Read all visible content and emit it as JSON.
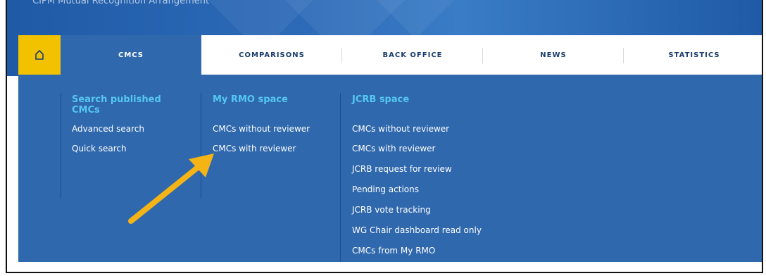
{
  "banner": {
    "title": "CIPM Mutual Recognition Arrangement"
  },
  "nav": {
    "home_icon": "home-icon",
    "items": [
      {
        "label": "CMCS"
      },
      {
        "label": "COMPARISONS"
      },
      {
        "label": "BACK OFFICE"
      },
      {
        "label": "NEWS"
      },
      {
        "label": "STATISTICS"
      }
    ]
  },
  "menu": {
    "columns": [
      {
        "heading": "Search published CMCs",
        "links": [
          "Advanced search",
          "Quick search"
        ]
      },
      {
        "heading": "My RMO space",
        "links": [
          "CMCs without reviewer",
          "CMCs with reviewer"
        ]
      },
      {
        "heading": "JCRB space",
        "links": [
          "CMCs without reviewer",
          "CMCs with reviewer",
          "JCRB request for review",
          "Pending actions",
          "JCRB vote tracking",
          "WG Chair dashboard read only",
          "CMCs from My RMO"
        ]
      }
    ]
  },
  "colors": {
    "accent_yellow": "#f2c200",
    "panel_blue": "#2f68ad",
    "heading_cyan": "#55c7f2",
    "arrow_orange": "#f5b416"
  }
}
